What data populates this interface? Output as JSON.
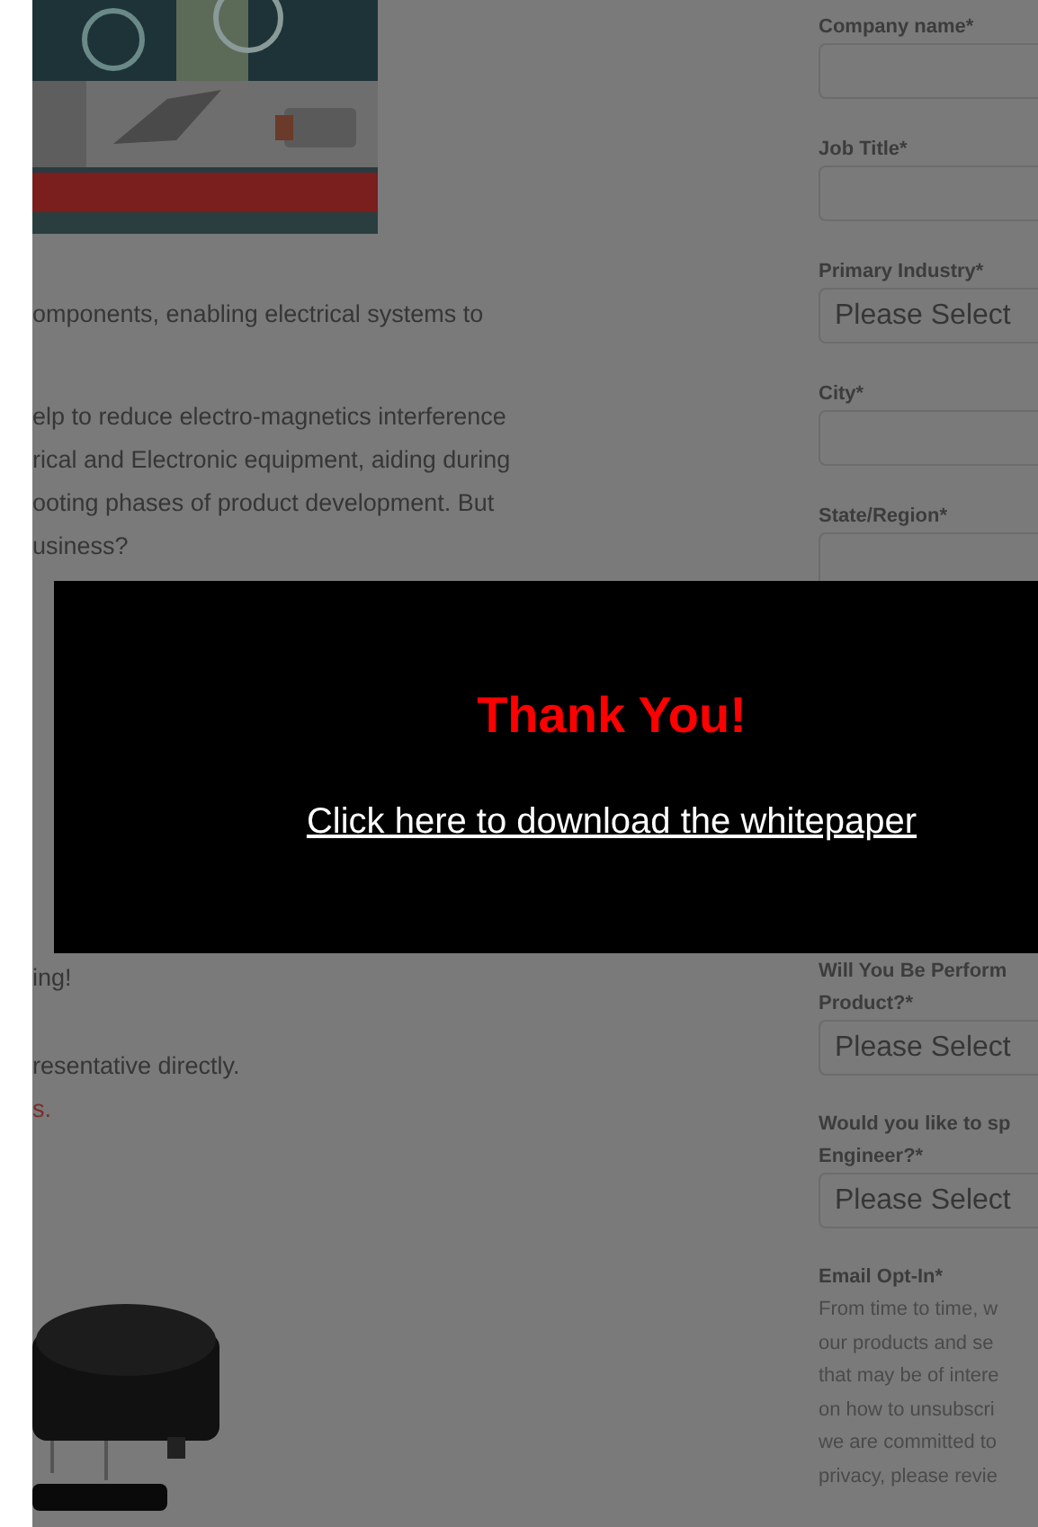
{
  "upper_paragraphs": [
    {
      "lines": [
        "omponents, enabling electrical systems to"
      ]
    },
    {
      "lines": [
        "elp to reduce electro-magnetics interference",
        "rical and Electronic equipment, aiding during",
        "ooting phases of product development. But",
        "usiness?"
      ]
    }
  ],
  "lower_paragraphs": [
    {
      "lines": [
        {
          "text": "ing!",
          "kind": "plain"
        }
      ]
    },
    {
      "lines": [
        {
          "text": "resentative directly.",
          "kind": "plain"
        },
        {
          "text": "s.",
          "kind": "link"
        }
      ]
    }
  ],
  "form_top": [
    {
      "label": "Company name*",
      "kind": "input"
    },
    {
      "label": "Job Title*",
      "kind": "input"
    },
    {
      "label": "Primary Industry*",
      "kind": "select",
      "value": "Please Select"
    },
    {
      "label": "City*",
      "kind": "input"
    },
    {
      "label": "State/Region*",
      "kind": "input"
    }
  ],
  "form_bottom": [
    {
      "label_lines": [
        "Will You Be Perform",
        "Product?*"
      ],
      "kind": "select",
      "value": "Please Select"
    },
    {
      "label_lines": [
        "Would you like to sp",
        "Engineer?*"
      ],
      "kind": "select",
      "value": "Please Select"
    }
  ],
  "email_opt_in": {
    "label": "Email Opt-In*",
    "lines": [
      "From time to time, w",
      "our products and se",
      "that may be of intere",
      "on how to unsubscri",
      "we are committed to",
      "privacy, please revie"
    ]
  },
  "modal": {
    "title": "Thank You!",
    "link": "Click here to download the whitepaper"
  }
}
